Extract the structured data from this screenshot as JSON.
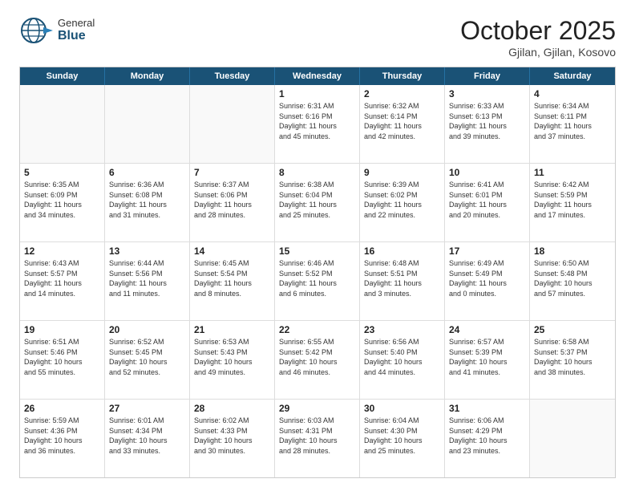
{
  "header": {
    "logo": {
      "general": "General",
      "blue": "Blue"
    },
    "title": "October 2025",
    "location": "Gjilan, Gjilan, Kosovo"
  },
  "days_of_week": [
    "Sunday",
    "Monday",
    "Tuesday",
    "Wednesday",
    "Thursday",
    "Friday",
    "Saturday"
  ],
  "weeks": [
    [
      {
        "day": "",
        "info": ""
      },
      {
        "day": "",
        "info": ""
      },
      {
        "day": "",
        "info": ""
      },
      {
        "day": "1",
        "info": "Sunrise: 6:31 AM\nSunset: 6:16 PM\nDaylight: 11 hours\nand 45 minutes."
      },
      {
        "day": "2",
        "info": "Sunrise: 6:32 AM\nSunset: 6:14 PM\nDaylight: 11 hours\nand 42 minutes."
      },
      {
        "day": "3",
        "info": "Sunrise: 6:33 AM\nSunset: 6:13 PM\nDaylight: 11 hours\nand 39 minutes."
      },
      {
        "day": "4",
        "info": "Sunrise: 6:34 AM\nSunset: 6:11 PM\nDaylight: 11 hours\nand 37 minutes."
      }
    ],
    [
      {
        "day": "5",
        "info": "Sunrise: 6:35 AM\nSunset: 6:09 PM\nDaylight: 11 hours\nand 34 minutes."
      },
      {
        "day": "6",
        "info": "Sunrise: 6:36 AM\nSunset: 6:08 PM\nDaylight: 11 hours\nand 31 minutes."
      },
      {
        "day": "7",
        "info": "Sunrise: 6:37 AM\nSunset: 6:06 PM\nDaylight: 11 hours\nand 28 minutes."
      },
      {
        "day": "8",
        "info": "Sunrise: 6:38 AM\nSunset: 6:04 PM\nDaylight: 11 hours\nand 25 minutes."
      },
      {
        "day": "9",
        "info": "Sunrise: 6:39 AM\nSunset: 6:02 PM\nDaylight: 11 hours\nand 22 minutes."
      },
      {
        "day": "10",
        "info": "Sunrise: 6:41 AM\nSunset: 6:01 PM\nDaylight: 11 hours\nand 20 minutes."
      },
      {
        "day": "11",
        "info": "Sunrise: 6:42 AM\nSunset: 5:59 PM\nDaylight: 11 hours\nand 17 minutes."
      }
    ],
    [
      {
        "day": "12",
        "info": "Sunrise: 6:43 AM\nSunset: 5:57 PM\nDaylight: 11 hours\nand 14 minutes."
      },
      {
        "day": "13",
        "info": "Sunrise: 6:44 AM\nSunset: 5:56 PM\nDaylight: 11 hours\nand 11 minutes."
      },
      {
        "day": "14",
        "info": "Sunrise: 6:45 AM\nSunset: 5:54 PM\nDaylight: 11 hours\nand 8 minutes."
      },
      {
        "day": "15",
        "info": "Sunrise: 6:46 AM\nSunset: 5:52 PM\nDaylight: 11 hours\nand 6 minutes."
      },
      {
        "day": "16",
        "info": "Sunrise: 6:48 AM\nSunset: 5:51 PM\nDaylight: 11 hours\nand 3 minutes."
      },
      {
        "day": "17",
        "info": "Sunrise: 6:49 AM\nSunset: 5:49 PM\nDaylight: 11 hours\nand 0 minutes."
      },
      {
        "day": "18",
        "info": "Sunrise: 6:50 AM\nSunset: 5:48 PM\nDaylight: 10 hours\nand 57 minutes."
      }
    ],
    [
      {
        "day": "19",
        "info": "Sunrise: 6:51 AM\nSunset: 5:46 PM\nDaylight: 10 hours\nand 55 minutes."
      },
      {
        "day": "20",
        "info": "Sunrise: 6:52 AM\nSunset: 5:45 PM\nDaylight: 10 hours\nand 52 minutes."
      },
      {
        "day": "21",
        "info": "Sunrise: 6:53 AM\nSunset: 5:43 PM\nDaylight: 10 hours\nand 49 minutes."
      },
      {
        "day": "22",
        "info": "Sunrise: 6:55 AM\nSunset: 5:42 PM\nDaylight: 10 hours\nand 46 minutes."
      },
      {
        "day": "23",
        "info": "Sunrise: 6:56 AM\nSunset: 5:40 PM\nDaylight: 10 hours\nand 44 minutes."
      },
      {
        "day": "24",
        "info": "Sunrise: 6:57 AM\nSunset: 5:39 PM\nDaylight: 10 hours\nand 41 minutes."
      },
      {
        "day": "25",
        "info": "Sunrise: 6:58 AM\nSunset: 5:37 PM\nDaylight: 10 hours\nand 38 minutes."
      }
    ],
    [
      {
        "day": "26",
        "info": "Sunrise: 5:59 AM\nSunset: 4:36 PM\nDaylight: 10 hours\nand 36 minutes."
      },
      {
        "day": "27",
        "info": "Sunrise: 6:01 AM\nSunset: 4:34 PM\nDaylight: 10 hours\nand 33 minutes."
      },
      {
        "day": "28",
        "info": "Sunrise: 6:02 AM\nSunset: 4:33 PM\nDaylight: 10 hours\nand 30 minutes."
      },
      {
        "day": "29",
        "info": "Sunrise: 6:03 AM\nSunset: 4:31 PM\nDaylight: 10 hours\nand 28 minutes."
      },
      {
        "day": "30",
        "info": "Sunrise: 6:04 AM\nSunset: 4:30 PM\nDaylight: 10 hours\nand 25 minutes."
      },
      {
        "day": "31",
        "info": "Sunrise: 6:06 AM\nSunset: 4:29 PM\nDaylight: 10 hours\nand 23 minutes."
      },
      {
        "day": "",
        "info": ""
      }
    ]
  ]
}
